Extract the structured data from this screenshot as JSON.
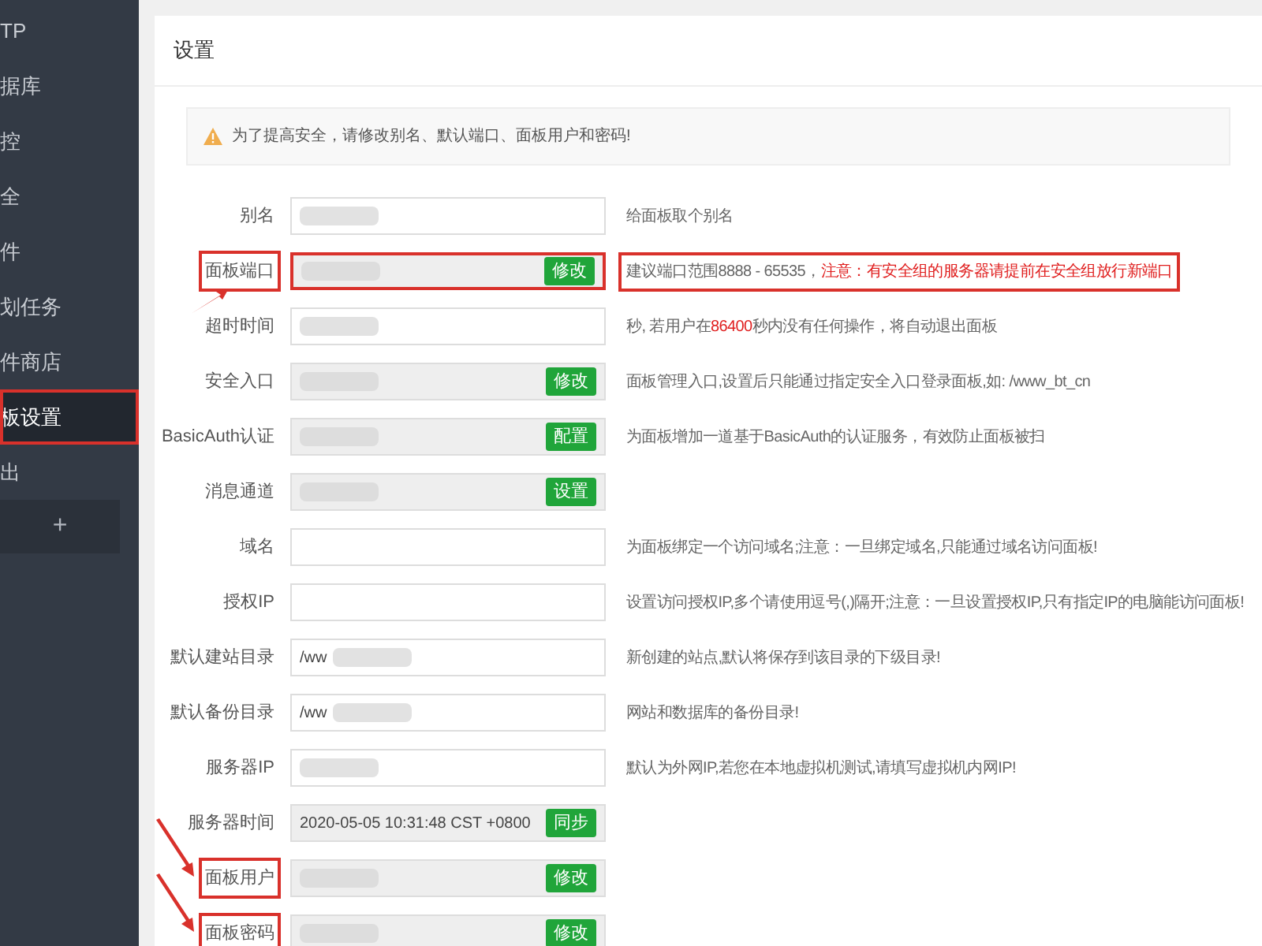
{
  "sidebar": {
    "items": [
      {
        "label": "TP",
        "selected": false,
        "highlighted": false
      },
      {
        "label": "据库",
        "selected": false,
        "highlighted": false
      },
      {
        "label": "控",
        "selected": false,
        "highlighted": false
      },
      {
        "label": "全",
        "selected": false,
        "highlighted": false
      },
      {
        "label": "件",
        "selected": false,
        "highlighted": false
      },
      {
        "label": "划任务",
        "selected": false,
        "highlighted": false
      },
      {
        "label": "件商店",
        "selected": false,
        "highlighted": false
      },
      {
        "label": "板设置",
        "selected": true,
        "highlighted": true
      },
      {
        "label": "出",
        "selected": false,
        "highlighted": false
      }
    ],
    "add_button": "+"
  },
  "page": {
    "title": "设置",
    "alert": "为了提高安全，请修改别名、默认端口、面板用户和密码!",
    "rows": [
      {
        "label": "别名",
        "value": "",
        "blurred": true,
        "disabled": false,
        "label_boxed": false,
        "field_boxed": false,
        "arrow_from_below": false,
        "arrow_from_above": false,
        "hint": [
          {
            "text": "给面板取个别名",
            "red": false
          }
        ],
        "hint_highlighted": false
      },
      {
        "label": "面板端口",
        "value": "",
        "blurred": true,
        "disabled": true,
        "button": "修改",
        "label_boxed": true,
        "field_boxed": true,
        "arrow_from_below": true,
        "arrow_from_above": false,
        "hint": [
          {
            "text": "建议端口范围8888 - 65535，",
            "red": false
          },
          {
            "text": "注意：有安全组的服务器请提前在安全组放行新端口",
            "red": true
          }
        ],
        "hint_highlighted": true
      },
      {
        "label": "超时时间",
        "value": "",
        "blurred": true,
        "disabled": false,
        "label_boxed": false,
        "field_boxed": false,
        "arrow_from_below": false,
        "arrow_from_above": false,
        "hint": [
          {
            "text": "秒, 若用户在",
            "red": false
          },
          {
            "text": "86400",
            "red": true
          },
          {
            "text": "秒内没有任何操作，将自动退出面板",
            "red": false
          }
        ],
        "hint_highlighted": false
      },
      {
        "label": "安全入口",
        "value": "",
        "blurred": true,
        "disabled": true,
        "button": "修改",
        "label_boxed": false,
        "field_boxed": false,
        "arrow_from_below": false,
        "arrow_from_above": false,
        "hint": [
          {
            "text": "面板管理入口,设置后只能通过指定安全入口登录面板,如: /www_bt_cn",
            "red": false
          }
        ],
        "hint_highlighted": false
      },
      {
        "label": "BasicAuth认证",
        "value": "",
        "blurred": true,
        "disabled": true,
        "button": "配置",
        "label_boxed": false,
        "field_boxed": false,
        "arrow_from_below": false,
        "arrow_from_above": false,
        "hint": [
          {
            "text": "为面板增加一道基于BasicAuth的认证服务，有效防止面板被扫",
            "red": false
          }
        ],
        "hint_highlighted": false
      },
      {
        "label": "消息通道",
        "value": "",
        "blurred": true,
        "disabled": true,
        "button": "设置",
        "label_boxed": false,
        "field_boxed": false,
        "arrow_from_below": false,
        "arrow_from_above": false
      },
      {
        "label": "域名",
        "value": "",
        "blurred": false,
        "disabled": false,
        "label_boxed": false,
        "field_boxed": false,
        "arrow_from_below": false,
        "arrow_from_above": false,
        "hint": [
          {
            "text": "为面板绑定一个访问域名;注意：一旦绑定域名,只能通过域名访问面板!",
            "red": false
          }
        ],
        "hint_highlighted": false
      },
      {
        "label": "授权IP",
        "value": "",
        "blurred": false,
        "disabled": false,
        "label_boxed": false,
        "field_boxed": false,
        "arrow_from_below": false,
        "arrow_from_above": false,
        "hint": [
          {
            "text": "设置访问授权IP,多个请使用逗号(,)隔开;注意：一旦设置授权IP,只有指定IP的电脑能访问面板!",
            "red": false
          }
        ],
        "hint_highlighted": false
      },
      {
        "label": "默认建站目录",
        "value": "/ww",
        "blurred": true,
        "disabled": false,
        "label_boxed": false,
        "field_boxed": false,
        "arrow_from_below": false,
        "arrow_from_above": false,
        "hint": [
          {
            "text": "新创建的站点,默认将保存到该目录的下级目录!",
            "red": false
          }
        ],
        "hint_highlighted": false
      },
      {
        "label": "默认备份目录",
        "value": "/ww",
        "blurred": true,
        "disabled": false,
        "label_boxed": false,
        "field_boxed": false,
        "arrow_from_below": false,
        "arrow_from_above": false,
        "hint": [
          {
            "text": "网站和数据库的备份目录!",
            "red": false
          }
        ],
        "hint_highlighted": false
      },
      {
        "label": "服务器IP",
        "value": "",
        "blurred": true,
        "disabled": false,
        "label_boxed": false,
        "field_boxed": false,
        "arrow_from_below": false,
        "arrow_from_above": false,
        "hint": [
          {
            "text": "默认为外网IP,若您在本地虚拟机测试,请填写虚拟机内网IP!",
            "red": false
          }
        ],
        "hint_highlighted": false
      },
      {
        "label": "服务器时间",
        "value": "2020-05-05 10:31:48 CST +0800",
        "blurred": false,
        "disabled": true,
        "button": "同步",
        "label_boxed": false,
        "field_boxed": false,
        "arrow_from_below": false,
        "arrow_from_above": false
      },
      {
        "label": "面板用户",
        "value": "",
        "blurred": true,
        "disabled": true,
        "button": "修改",
        "label_boxed": true,
        "field_boxed": false,
        "arrow_from_below": false,
        "arrow_from_above": true
      },
      {
        "label": "面板密码",
        "value": "",
        "blurred": true,
        "disabled": true,
        "button": "修改",
        "label_boxed": true,
        "field_boxed": false,
        "arrow_from_below": false,
        "arrow_from_above": true
      }
    ]
  }
}
